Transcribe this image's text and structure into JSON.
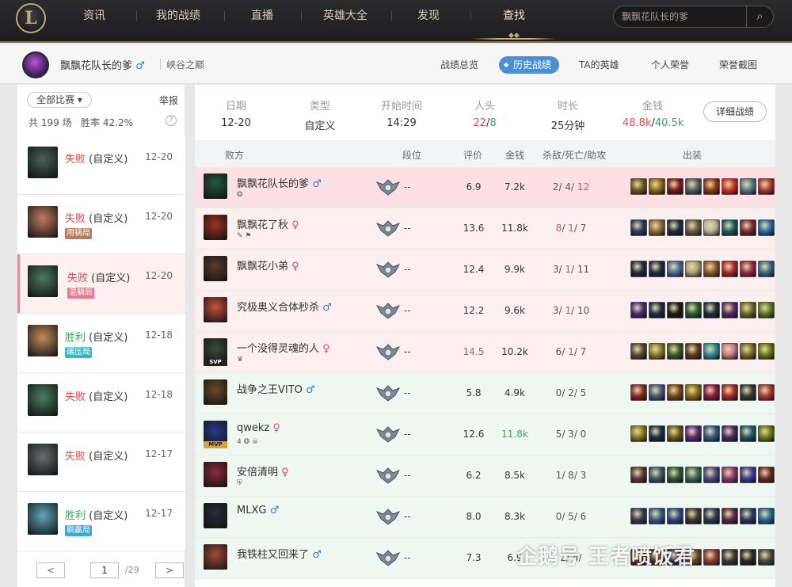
{
  "nav": {
    "items": [
      "资讯",
      "我的战绩",
      "直播",
      "英雄大全",
      "发现",
      "查找"
    ],
    "active_index": 5,
    "search_placeholder": "飘飘花队长的爹",
    "logo_text": "L"
  },
  "profile": {
    "name": "飘飘花队长的爹",
    "gender": "♂",
    "server": "峡谷之巅",
    "tabs": [
      "战绩总览",
      "历史战绩",
      "TA的英雄",
      "个人荣誉",
      "荣誉截图"
    ],
    "active_tab": 1
  },
  "left": {
    "filter_label": "全部比赛",
    "filter_arrow": "▾",
    "report_label": "举报",
    "stats_prefix": "共",
    "stats_total": "199",
    "stats_unit": "场",
    "winrate_label": "胜率",
    "winrate_value": "42.2%",
    "help_label": "?",
    "matches": [
      {
        "result": "失败",
        "mode": "(自定义)",
        "date": "12-20",
        "tag": "",
        "tag_color": "",
        "outcome": "lose",
        "selected": false,
        "champ_color": "#1c3a2e"
      },
      {
        "result": "失败",
        "mode": "(自定义)",
        "date": "12-20",
        "tag": "用锅局",
        "tag_color": "#b87b5c",
        "outcome": "lose",
        "selected": false,
        "champ_color": "#b2593a"
      },
      {
        "result": "失败",
        "mode": "(自定义)",
        "date": "12-20",
        "tag": "混躺局",
        "tag_color": "#e87a8c",
        "outcome": "lose",
        "selected": true,
        "champ_color": "#1f5b3c"
      },
      {
        "result": "胜利",
        "mode": "(自定义)",
        "date": "12-18",
        "tag": "碾压局",
        "tag_color": "#3bb6c9",
        "outcome": "win",
        "selected": false,
        "champ_color": "#b36f36"
      },
      {
        "result": "失败",
        "mode": "(自定义)",
        "date": "12-18",
        "tag": "",
        "tag_color": "",
        "outcome": "lose",
        "selected": false,
        "champ_color": "#1f5b3c"
      },
      {
        "result": "失败",
        "mode": "(自定义)",
        "date": "12-17",
        "tag": "",
        "tag_color": "",
        "outcome": "lose",
        "selected": false,
        "champ_color": "#3f4a4a"
      },
      {
        "result": "胜利",
        "mode": "(自定义)",
        "date": "12-17",
        "tag": "躺赢局",
        "tag_color": "#3ba9d9",
        "outcome": "win",
        "selected": false,
        "champ_color": "#3a8fa5"
      }
    ],
    "pager": {
      "prev": "<",
      "current": "1",
      "total": "/29",
      "next": ">"
    }
  },
  "summary": {
    "date_label": "日期",
    "date": "12-20",
    "type_label": "类型",
    "type": "自定义",
    "start_label": "开始时间",
    "start": "14:29",
    "kills_label": "人头",
    "kills_a": "22",
    "kills_sep": "/",
    "kills_b": "8",
    "duration_label": "时长",
    "duration": "25分钟",
    "gold_label": "金钱",
    "gold_a": "48.8k",
    "gold_sep": "/",
    "gold_b": "40.5k",
    "detail_btn": "详细战绩"
  },
  "table_headers": {
    "team": "败方",
    "rank": "段位",
    "score": "评价",
    "gold": "金钱",
    "kda": "杀敌/死亡/助攻",
    "items": "出装"
  },
  "players": [
    {
      "name": "飘飘花队长的爹",
      "gender": "♂",
      "sub": "❂",
      "badge": "",
      "rank": "--",
      "score": "6.9",
      "score_color": "#333",
      "gold": "7.2k",
      "gold_color": "#333",
      "k": "2",
      "d": "4",
      "a": "12",
      "red_idx": [
        2
      ],
      "row": "me",
      "champ_color": "#1f5b3c",
      "items": [
        "#6b5a2a",
        "#8a6a1e",
        "#7a1d1d",
        "#56606a",
        "#8b3a1e",
        "#c8342b",
        "#5a7a8a",
        "#a93b3b"
      ]
    },
    {
      "name": "飘飘花了秋",
      "gender": "♀",
      "sub": "✎ ⚑",
      "badge": "",
      "rank": "--",
      "score": "13.6",
      "score_color": "#333",
      "gold": "11.8k",
      "gold_color": "#333",
      "k": "8",
      "d": "1",
      "a": "7",
      "red_idx": [
        0,
        1
      ],
      "row": "lost",
      "champ_color": "#9a3320",
      "items": [
        "#2f3a66",
        "#8a6a3e",
        "#1e2e44",
        "#6a5a4a",
        "#b8b0a0",
        "#1c5c66",
        "#7a2a3a",
        "#2a6aa8"
      ]
    },
    {
      "name": "飘飘花小弟",
      "gender": "♀",
      "sub": "",
      "badge": "",
      "rank": "--",
      "score": "12.4",
      "score_color": "#333",
      "gold": "9.9k",
      "gold_color": "#333",
      "k": "3",
      "d": "1",
      "a": "11",
      "red_idx": [
        1
      ],
      "row": "lost",
      "champ_color": "#5a3a2a",
      "items": [
        "#1e2e44",
        "#1e2e44",
        "#4a6a9a",
        "#b0a078",
        "#8a5a2a",
        "#a82a2a",
        "#9a2a4a",
        "#3a6a8a"
      ]
    },
    {
      "name": "究极奥义合体秒杀",
      "gender": "♂",
      "sub": "",
      "badge": "",
      "rank": "--",
      "score": "12.2",
      "score_color": "#333",
      "gold": "9.6k",
      "gold_color": "#333",
      "k": "3",
      "d": "1",
      "a": "10",
      "red_idx": [
        1
      ],
      "row": "lost",
      "champ_color": "#c6513a",
      "items": [
        "#4a2a7a",
        "#1e2e44",
        "#1a1a1a",
        "#2a5a3a",
        "#1e2e44",
        "#5a2a6a",
        "#6a6a2a",
        "#5a7a2a"
      ]
    },
    {
      "name": "一个没得灵魂的人",
      "gender": "♀",
      "sub": "♛",
      "badge": "SVP",
      "rank": "--",
      "score": "14.5",
      "score_color": "#e24c4c",
      "gold": "10.2k",
      "gold_color": "#333",
      "k": "6",
      "d": "1",
      "a": "7",
      "red_idx": [
        1
      ],
      "row": "lost",
      "champ_color": "#3a4a3a",
      "items": [
        "#5a4a3a",
        "#8a7a2a",
        "#3a5a2a",
        "#5a3a2a",
        "#2a8a9a",
        "#c87a8a",
        "#7a6a2a",
        "#6a7a1a"
      ]
    },
    {
      "name": "战争之王VITO",
      "gender": "♂",
      "sub": "",
      "badge": "",
      "rank": "--",
      "score": "5.8",
      "score_color": "#333",
      "gold": "4.9k",
      "gold_color": "#333",
      "k": "0",
      "d": "2",
      "a": "5",
      "red_idx": [],
      "row": "won",
      "champ_color": "#6a4a2a",
      "items": [
        "#8a2a2a",
        "#4a5a7a",
        "#7a4a1a",
        "#8a6a1a",
        "#8a1a4a",
        "#a82a2a",
        "#3a3a3a",
        "#a83a3a"
      ]
    },
    {
      "name": "qwekz",
      "gender": "♀",
      "sub": "4 ❂ ☠",
      "badge": "MVP",
      "rank": "--",
      "score": "12.6",
      "score_color": "#333",
      "gold": "11.8k",
      "gold_color": "#3ea55c",
      "k": "5",
      "d": "3",
      "a": "0",
      "red_idx": [],
      "row": "won",
      "champ_color": "#2a3a8a",
      "items": [
        "#8a7a1a",
        "#1e2e44",
        "#6a5a1a",
        "#5a2a7a",
        "#2a5a8a",
        "#4a2a6a",
        "#1a5a6a",
        "#6a7a1a"
      ]
    },
    {
      "name": "安倍清明",
      "gender": "♀",
      "sub": "⛨",
      "badge": "",
      "rank": "--",
      "score": "6.2",
      "score_color": "#333",
      "gold": "8.5k",
      "gold_color": "#333",
      "k": "1",
      "d": "8",
      "a": "3",
      "red_idx": [],
      "row": "won",
      "champ_color": "#8a2a3a",
      "items": [
        "#5a3a3a",
        "#3a5a6a",
        "#2a5a3a",
        "#3a6a5a",
        "#4a4a8a",
        "#8a3a6a",
        "#3a3a9a",
        "#6a2a2a"
      ]
    },
    {
      "name": "MLXG",
      "gender": "♂",
      "sub": "",
      "badge": "",
      "rank": "--",
      "score": "8.0",
      "score_color": "#333",
      "gold": "8.3k",
      "gold_color": "#333",
      "k": "0",
      "d": "5",
      "a": "6",
      "red_idx": [],
      "row": "won",
      "champ_color": "#2a2a3a",
      "items": [
        "#3a3a5a",
        "#3a5a8a",
        "#2a4a8a",
        "#3a3a3a",
        "#2a3a5a",
        "#5a2a4a",
        "#2a3a6a",
        "#2a6a9a"
      ]
    },
    {
      "name": "我铁柱又回来了",
      "gender": "♂",
      "sub": "",
      "badge": "",
      "rank": "--",
      "score": "7.3",
      "score_color": "#333",
      "gold": "6.9",
      "gold_color": "#333",
      "k": "2",
      "d": "4",
      "a": "",
      "red_idx": [],
      "row": "won",
      "champ_color": "#a24a3a",
      "items": [
        "#5a3a2a",
        "#4a2a2a",
        "#3a2a5a",
        "#6a4a2a",
        "#8a3a3a",
        "#3a3a3a",
        "#2a2a2a",
        "#4a4a4a"
      ]
    }
  ],
  "watermark": "企鹅号 王者喷饭君"
}
